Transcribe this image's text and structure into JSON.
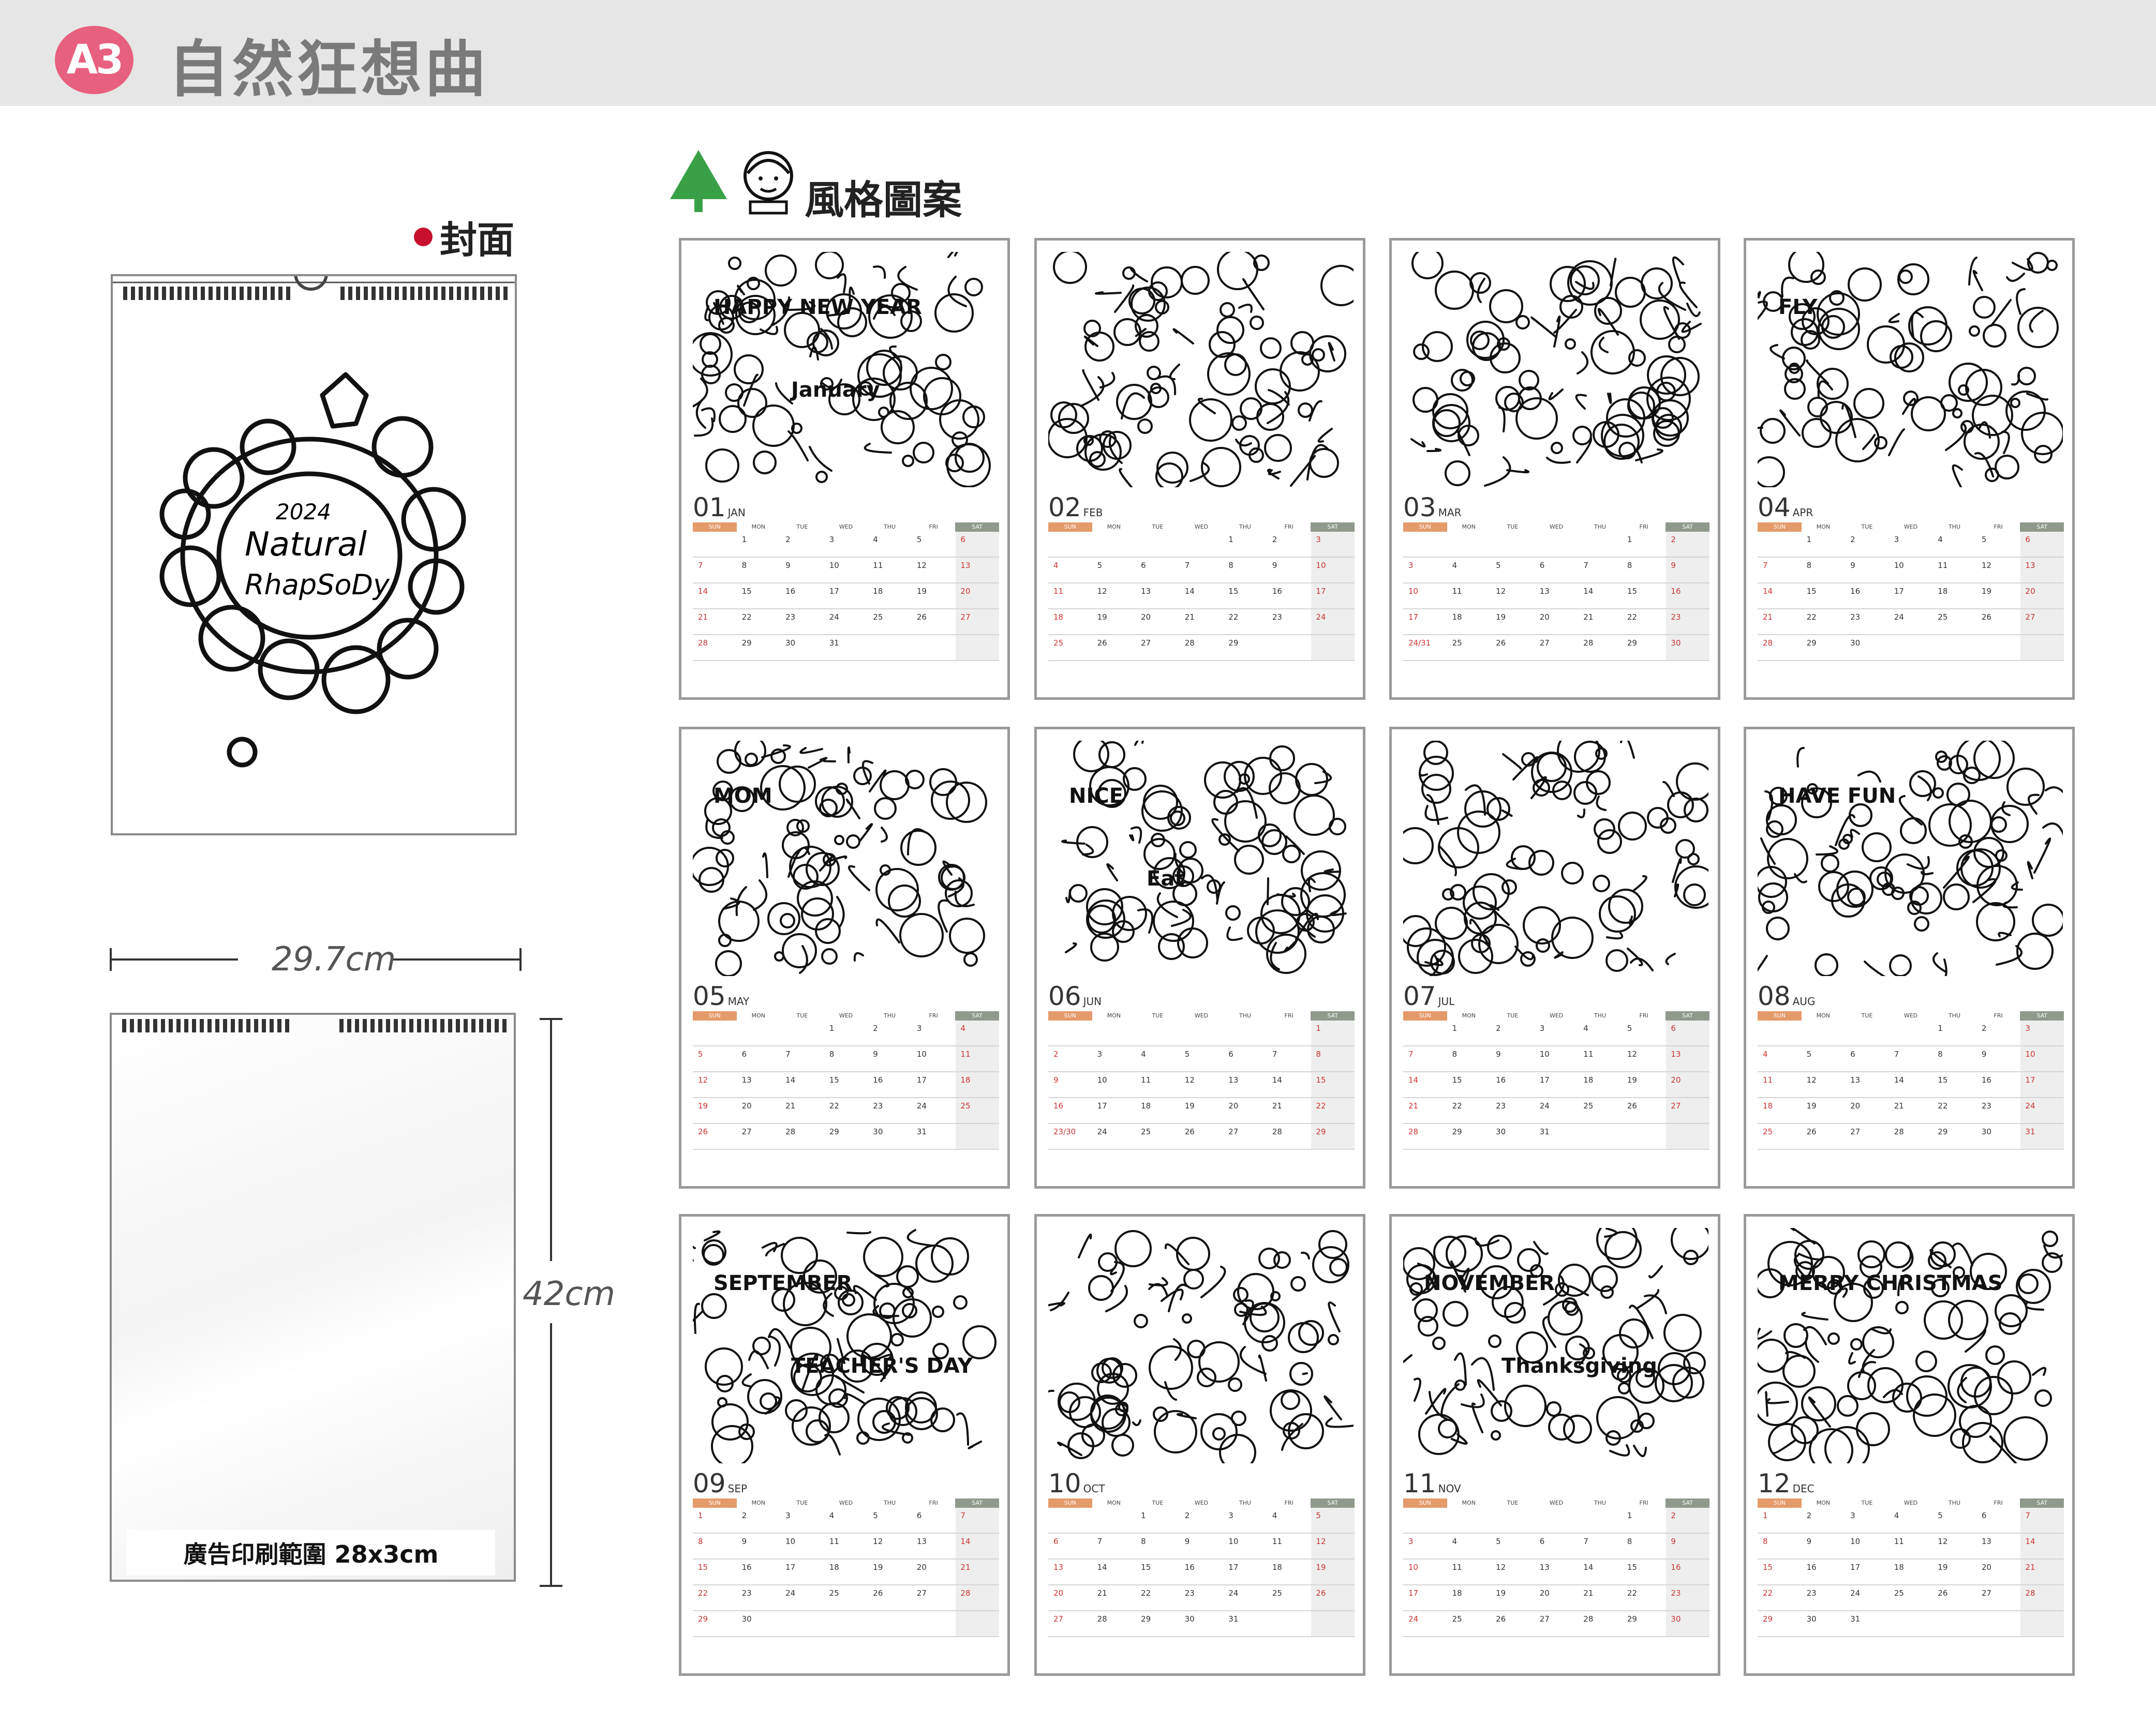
{
  "header": {
    "badge": "A3",
    "title": "自然狂想曲"
  },
  "cover": {
    "label": "封面",
    "art_lines": [
      "2024",
      "Natural",
      "RhapSoDy"
    ]
  },
  "dimensions": {
    "width": "29.7cm",
    "height": "42cm",
    "ad_area": "廣告印刷範圍 28x3cm"
  },
  "style_section": {
    "label": "風格圖案"
  },
  "colors": {
    "badge": "#e8607f",
    "sunday_header": "#e59a6a",
    "saturday_header": "#8f9a8d",
    "cover_dot": "#c8102e"
  },
  "weekdays": [
    "SUN",
    "MON",
    "TUE",
    "WED",
    "THU",
    "FRI",
    "SAT"
  ],
  "months": [
    {
      "num": "01",
      "abbr": "JAN"
    },
    {
      "num": "02",
      "abbr": "FEB"
    },
    {
      "num": "03",
      "abbr": "MAR"
    },
    {
      "num": "04",
      "abbr": "APR"
    },
    {
      "num": "05",
      "abbr": "MAY"
    },
    {
      "num": "06",
      "abbr": "JUN"
    },
    {
      "num": "07",
      "abbr": "JUL"
    },
    {
      "num": "08",
      "abbr": "AUG"
    },
    {
      "num": "09",
      "abbr": "SEP"
    },
    {
      "num": "10",
      "abbr": "OCT"
    },
    {
      "num": "11",
      "abbr": "NOV"
    },
    {
      "num": "12",
      "abbr": "DEC"
    }
  ],
  "art_text": [
    "HAPPY NEW YEAR",
    "January",
    "MOM",
    "NICE",
    "HAVE FUN",
    "SEPTEMBER",
    "TEACHER'S DAY",
    "NOVEMBER",
    "Thanksgiving",
    "MERRY CHRISTMAS",
    "FLY",
    "Eat"
  ]
}
